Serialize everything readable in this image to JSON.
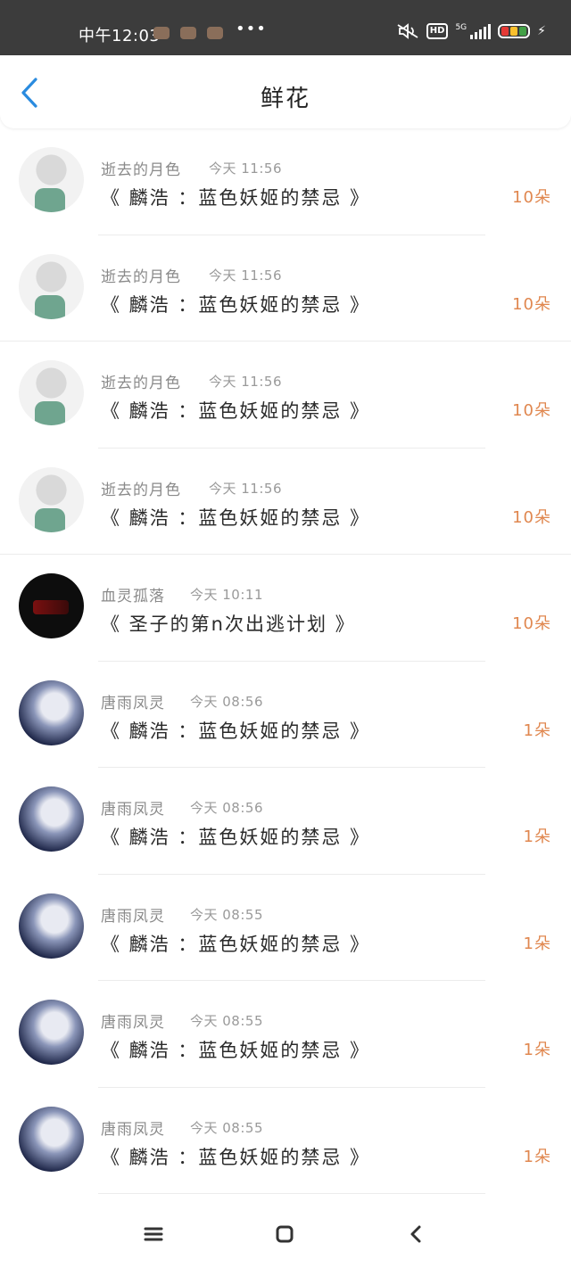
{
  "status_bar": {
    "time": "中午12:03",
    "more": "•••",
    "hd": "HD",
    "network": "5G",
    "battery_colors": [
      "#e53935",
      "#fbc02d",
      "#43a047"
    ]
  },
  "header": {
    "title": "鲜花",
    "back_icon": "chevron-left-icon"
  },
  "entries": [
    {
      "name": "逝去的月色",
      "time": "今天 11:56",
      "book": "《 麟浩 ：蓝色妖姬的禁忌 》",
      "count": "10朵"
    },
    {
      "name": "逝去的月色",
      "time": "今天 11:56",
      "book": "《 麟浩 ：蓝色妖姬的禁忌 》",
      "count": "10朵"
    },
    {
      "name": "逝去的月色",
      "time": "今天 11:56",
      "book": "《 麟浩 ：蓝色妖姬的禁忌 》",
      "count": "10朵"
    },
    {
      "name": "逝去的月色",
      "time": "今天 11:56",
      "book": "《 麟浩 ：蓝色妖姬的禁忌 》",
      "count": "10朵"
    },
    {
      "name": "血灵孤落",
      "time": "今天 10:11",
      "book": "《 圣子的第n次出逃计划 》",
      "count": "10朵"
    },
    {
      "name": "唐雨凤灵",
      "time": "今天 08:56",
      "book": "《 麟浩 ：蓝色妖姬的禁忌 》",
      "count": "1朵"
    },
    {
      "name": "唐雨凤灵",
      "time": "今天 08:56",
      "book": "《 麟浩 ：蓝色妖姬的禁忌 》",
      "count": "1朵"
    },
    {
      "name": "唐雨凤灵",
      "time": "今天 08:55",
      "book": "《 麟浩 ：蓝色妖姬的禁忌 》",
      "count": "1朵"
    },
    {
      "name": "唐雨凤灵",
      "time": "今天 08:55",
      "book": "《 麟浩 ：蓝色妖姬的禁忌 》",
      "count": "1朵"
    },
    {
      "name": "唐雨凤灵",
      "time": "今天 08:55",
      "book": "《 麟浩 ：蓝色妖姬的禁忌 》",
      "count": "1朵"
    }
  ],
  "nav_bar": {
    "menu_icon": "menu-icon",
    "home_icon": "home-icon",
    "back_icon": "back-icon"
  },
  "colors": {
    "accent": "#2a8bdf",
    "count": "#e0874f"
  }
}
